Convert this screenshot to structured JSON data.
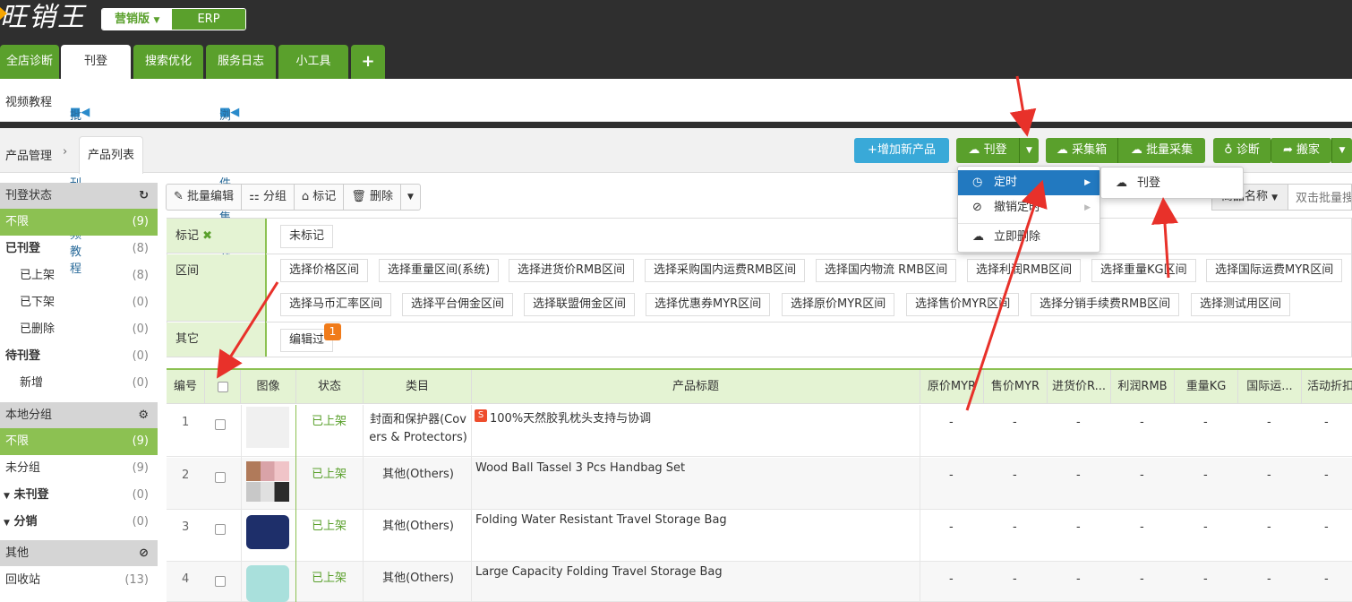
{
  "app": {
    "logo_text": "旺销王",
    "version_label": "营销版",
    "erp_label": "ERP"
  },
  "tabs": [
    {
      "label": "全店诊断"
    },
    {
      "label": "刊登"
    },
    {
      "label": "搜索优化"
    },
    {
      "label": "服务日志"
    },
    {
      "label": "小工具"
    },
    {
      "label": "+"
    }
  ],
  "subbar": {
    "video_label": "视频教程",
    "link1": "批量采集刊登视频教程",
    "link2": "浏览器插件采集视频教程"
  },
  "breadcrumb": {
    "parent": "产品管理",
    "separator": "›",
    "current": "产品列表"
  },
  "actions": {
    "add_product": "增加新产品",
    "publish": "刊登",
    "collect_box": "采集箱",
    "batch_collect": "批量采集",
    "diagnose": "诊断",
    "move": "搬家"
  },
  "publish_menu": {
    "items": [
      "定时",
      "撤销定时",
      "立即删除"
    ],
    "submenu": [
      "刊登"
    ]
  },
  "search": {
    "field_label": "商品名称",
    "placeholder": "双击批量搜"
  },
  "sidebar": {
    "status_title": "刊登状态",
    "status_items": [
      {
        "label": "不限",
        "count": "(9)"
      },
      {
        "label": "已刊登",
        "count": "(8)"
      },
      {
        "label": "已上架",
        "count": "(8)"
      },
      {
        "label": "已下架",
        "count": "(0)"
      },
      {
        "label": "已删除",
        "count": "(0)"
      },
      {
        "label": "待刊登",
        "count": "(0)"
      },
      {
        "label": "新增",
        "count": "(0)"
      }
    ],
    "group_title": "本地分组",
    "group_items": [
      {
        "label": "不限",
        "count": "(9)"
      },
      {
        "label": "未分组",
        "count": "(9)"
      },
      {
        "label": "未刊登",
        "count": "(0)"
      },
      {
        "label": "分销",
        "count": "(0)"
      }
    ],
    "other_title": "其他",
    "other_items": [
      {
        "label": "回收站",
        "count": "(13)"
      }
    ]
  },
  "toolbar": {
    "batch_edit": "批量编辑",
    "group": "分组",
    "mark": "标记",
    "delete": "删除"
  },
  "filters": {
    "mark_label": "标记",
    "mark_chip": "未标记",
    "range_label": "区间",
    "range_chips_row1": [
      "选择价格区间",
      "选择重量区间(系统)",
      "选择进货价RMB区间",
      "选择采购国内运费RMB区间",
      "选择国内物流 RMB区间",
      "选择利润RMB区间",
      "选择重量KG区间",
      "选择国际运费MYR区间"
    ],
    "range_chips_row2": [
      "选择马币汇率区间",
      "选择平台佣金区间",
      "选择联盟佣金区间",
      "选择优惠券MYR区间",
      "选择原价MYR区间",
      "选择售价MYR区间",
      "选择分销手续费RMB区间",
      "选择测试用区间"
    ],
    "other_label": "其它",
    "other_chip": "编辑过",
    "other_badge": "1"
  },
  "table": {
    "headers": [
      "编号",
      "",
      "图像",
      "状态",
      "类目",
      "产品标题",
      "原价MYR",
      "售价MYR",
      "进货价R...",
      "利润RMB",
      "重量KG",
      "国际运...",
      "活动折扣"
    ],
    "rows": [
      {
        "id": "1",
        "status": "已上架",
        "category": "封面和保护器(Covers & Protectors)",
        "title": "100%天然胶乳枕头支持与协调",
        "shop_badge": "S"
      },
      {
        "id": "2",
        "status": "已上架",
        "category": "其他(Others)",
        "title": "Wood Ball Tassel 3 Pcs Handbag Set"
      },
      {
        "id": "3",
        "status": "已上架",
        "category": "其他(Others)",
        "title": "Folding Water Resistant Travel Storage Bag"
      },
      {
        "id": "4",
        "status": "已上架",
        "category": "其他(Others)",
        "title": "Large Capacity Folding Travel Storage Bag"
      }
    ],
    "empty_cell": "-"
  },
  "colors": {
    "brand_green": "#5aa02c",
    "light_green": "#8cc152",
    "accent_blue": "#39a9d8",
    "menu_select": "#2279c0",
    "annotation_red": "#e8312a"
  }
}
